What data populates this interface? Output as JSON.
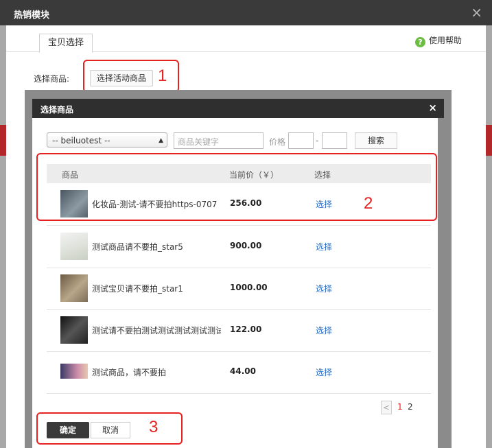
{
  "outer": {
    "title": "热销模块",
    "close": "×"
  },
  "tabs": [
    {
      "label": "宝贝选择"
    }
  ],
  "help": {
    "icon": "question-circle-icon",
    "label": "使用帮助"
  },
  "choose": {
    "label": "选择商品:",
    "button": "选择活动商品"
  },
  "annotations": [
    "1",
    "2",
    "3"
  ],
  "dialog": {
    "title": "选择商品",
    "close": "×",
    "filter": {
      "shop_select": "-- beiluotest --",
      "keyword_placeholder": "商品关键字",
      "price_label": "价格",
      "price_separator": "-",
      "search_button": "搜索"
    },
    "table": {
      "headers": [
        "商品",
        "当前价（￥）",
        "选择"
      ],
      "rows": [
        {
          "name": "化妆品-测试-请不要拍https-0707",
          "price": "256.00",
          "action": "选择"
        },
        {
          "name": "测试商品请不要拍_star5",
          "price": "900.00",
          "action": "选择"
        },
        {
          "name": "测试宝贝请不要拍_star1",
          "price": "1000.00",
          "action": "选择"
        },
        {
          "name": "测试请不要拍测试测试测试测试测试",
          "price": "122.00",
          "action": "选择"
        },
        {
          "name": "测试商品，请不要拍",
          "price": "44.00",
          "action": "选择"
        }
      ]
    },
    "pagination": {
      "prev": "<",
      "pages": [
        "1",
        "2"
      ],
      "current": "1"
    },
    "confirm": "确定",
    "cancel": "取消"
  },
  "colors": {
    "annotation_red": "#e52121",
    "link_blue": "#2a6fc7",
    "title_bar": "#2f2f2f"
  }
}
